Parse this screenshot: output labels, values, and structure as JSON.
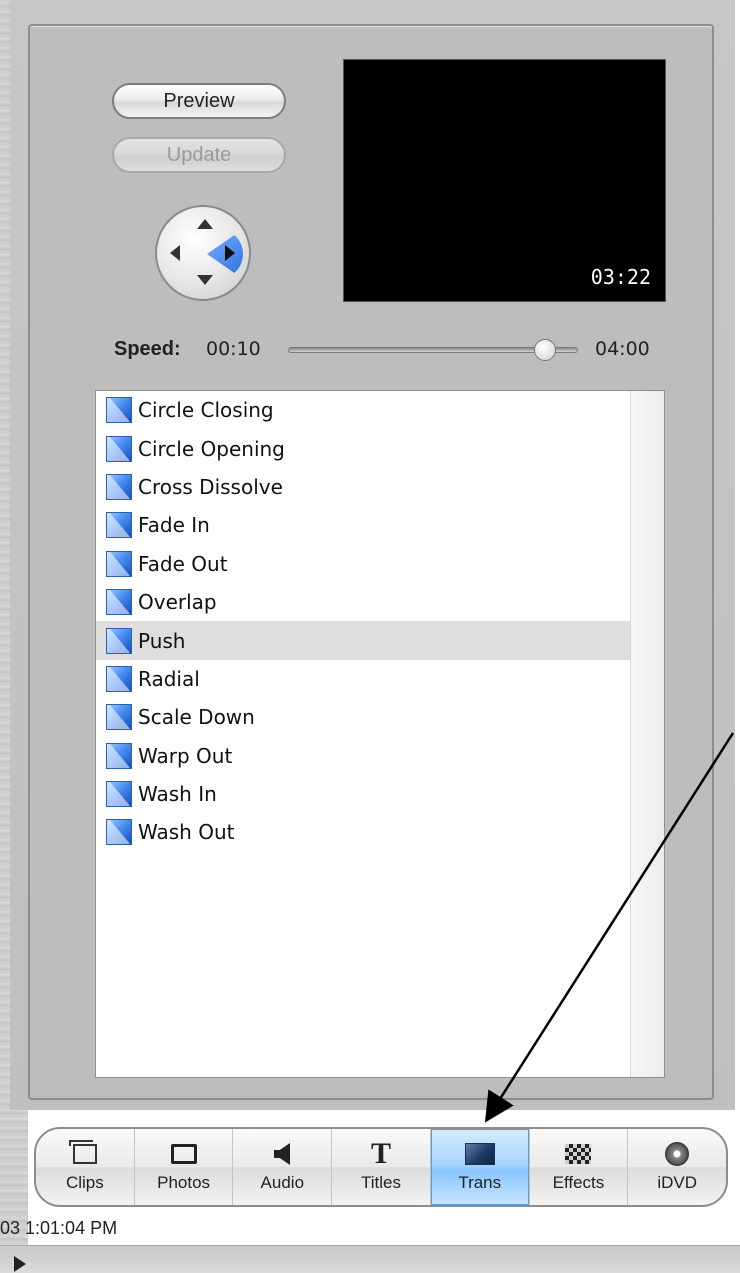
{
  "buttons": {
    "preview_label": "Preview",
    "update_label": "Update"
  },
  "monitor": {
    "timecode": "03:22"
  },
  "speed": {
    "label": "Speed:",
    "min": "00:10",
    "max": "04:00",
    "value_fraction": 0.89
  },
  "transitions": {
    "selected": "Push",
    "items": [
      "Circle Closing",
      "Circle Opening",
      "Cross Dissolve",
      "Fade In",
      "Fade Out",
      "Overlap",
      "Push",
      "Radial",
      "Scale Down",
      "Warp Out",
      "Wash In",
      "Wash Out"
    ]
  },
  "toolbar": {
    "active": "Trans",
    "buttons": [
      {
        "label": "Clips",
        "icon": "clips-icon"
      },
      {
        "label": "Photos",
        "icon": "photos-icon"
      },
      {
        "label": "Audio",
        "icon": "audio-icon"
      },
      {
        "label": "Titles",
        "icon": "titles-icon"
      },
      {
        "label": "Trans",
        "icon": "transitions-icon"
      },
      {
        "label": "Effects",
        "icon": "effects-icon"
      },
      {
        "label": "iDVD",
        "icon": "idvd-icon"
      }
    ]
  },
  "status": {
    "date_text": "03 1:01:04 PM"
  },
  "colors": {
    "active_tab": "#a9d6ff",
    "selection": "#dedede",
    "accent_blue": "#2a6fe0"
  }
}
